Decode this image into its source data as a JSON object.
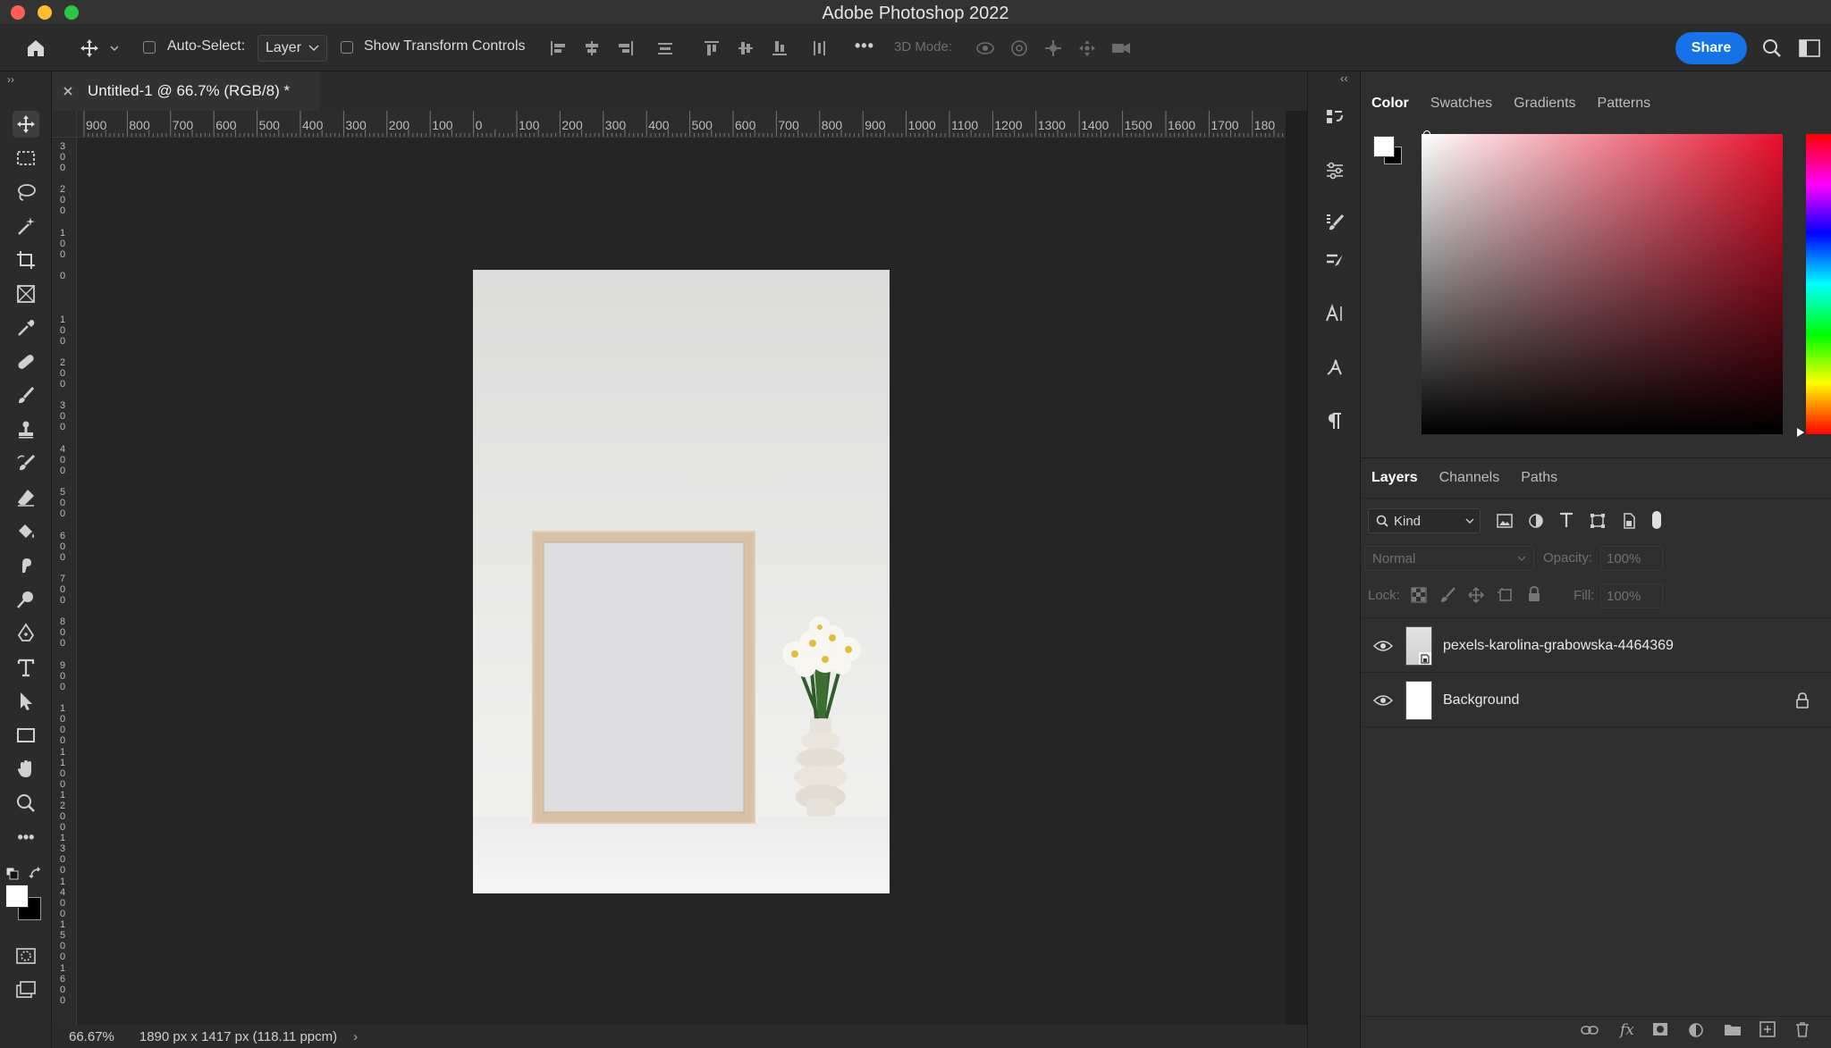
{
  "app": {
    "title": "Adobe Photoshop 2022"
  },
  "options_bar": {
    "auto_select_label": "Auto-Select:",
    "auto_select_value": "Layer",
    "show_transform_label": "Show Transform Controls",
    "more_label": "•••",
    "three_d_label": "3D Mode:",
    "share_label": "Share"
  },
  "document": {
    "tab_title": "Untitled-1 @ 66.7% (RGB/8) *",
    "ruler_h": [
      "900",
      "800",
      "700",
      "600",
      "500",
      "400",
      "300",
      "200",
      "100",
      "0",
      "100",
      "200",
      "300",
      "400",
      "500",
      "600",
      "700",
      "800",
      "900",
      "1000",
      "1100",
      "1200",
      "1300",
      "1400",
      "1500",
      "1600",
      "1700",
      "180"
    ],
    "ruler_v": [
      "3\n0\n0",
      "2\n0\n0",
      "1\n0\n0",
      "0",
      "1\n0\n0",
      "2\n0\n0",
      "3\n0\n0",
      "4\n0\n0",
      "5\n0\n0",
      "6\n0\n0",
      "7\n0\n0",
      "8\n0\n0",
      "9\n0\n0",
      "1\n0\n0\n0",
      "1\n1\n0\n0",
      "1\n2\n0\n0",
      "1\n3\n0\n0",
      "1\n4\n0\n0",
      "1\n5\n0\n0",
      "1\n6\n0\n0"
    ],
    "zoom": "66.67%",
    "dimensions": "1890 px x 1417 px (118.11 ppcm)"
  },
  "color_panel": {
    "tabs": [
      "Color",
      "Swatches",
      "Gradients",
      "Patterns"
    ],
    "hue_color": "#e8102c"
  },
  "layers_panel": {
    "tabs": [
      "Layers",
      "Channels",
      "Paths"
    ],
    "filter_kind": "Kind",
    "blend_mode": "Normal",
    "opacity_label": "Opacity:",
    "opacity_value": "100%",
    "lock_label": "Lock:",
    "fill_label": "Fill:",
    "fill_value": "100%",
    "layers": [
      {
        "name": "pexels-karolina-grabowska-4464369",
        "visible": true,
        "locked": false
      },
      {
        "name": "Background",
        "visible": true,
        "locked": true
      }
    ]
  },
  "colors": {
    "accent": "#1473e6",
    "foreground": "#ffffff",
    "background": "#000000"
  }
}
